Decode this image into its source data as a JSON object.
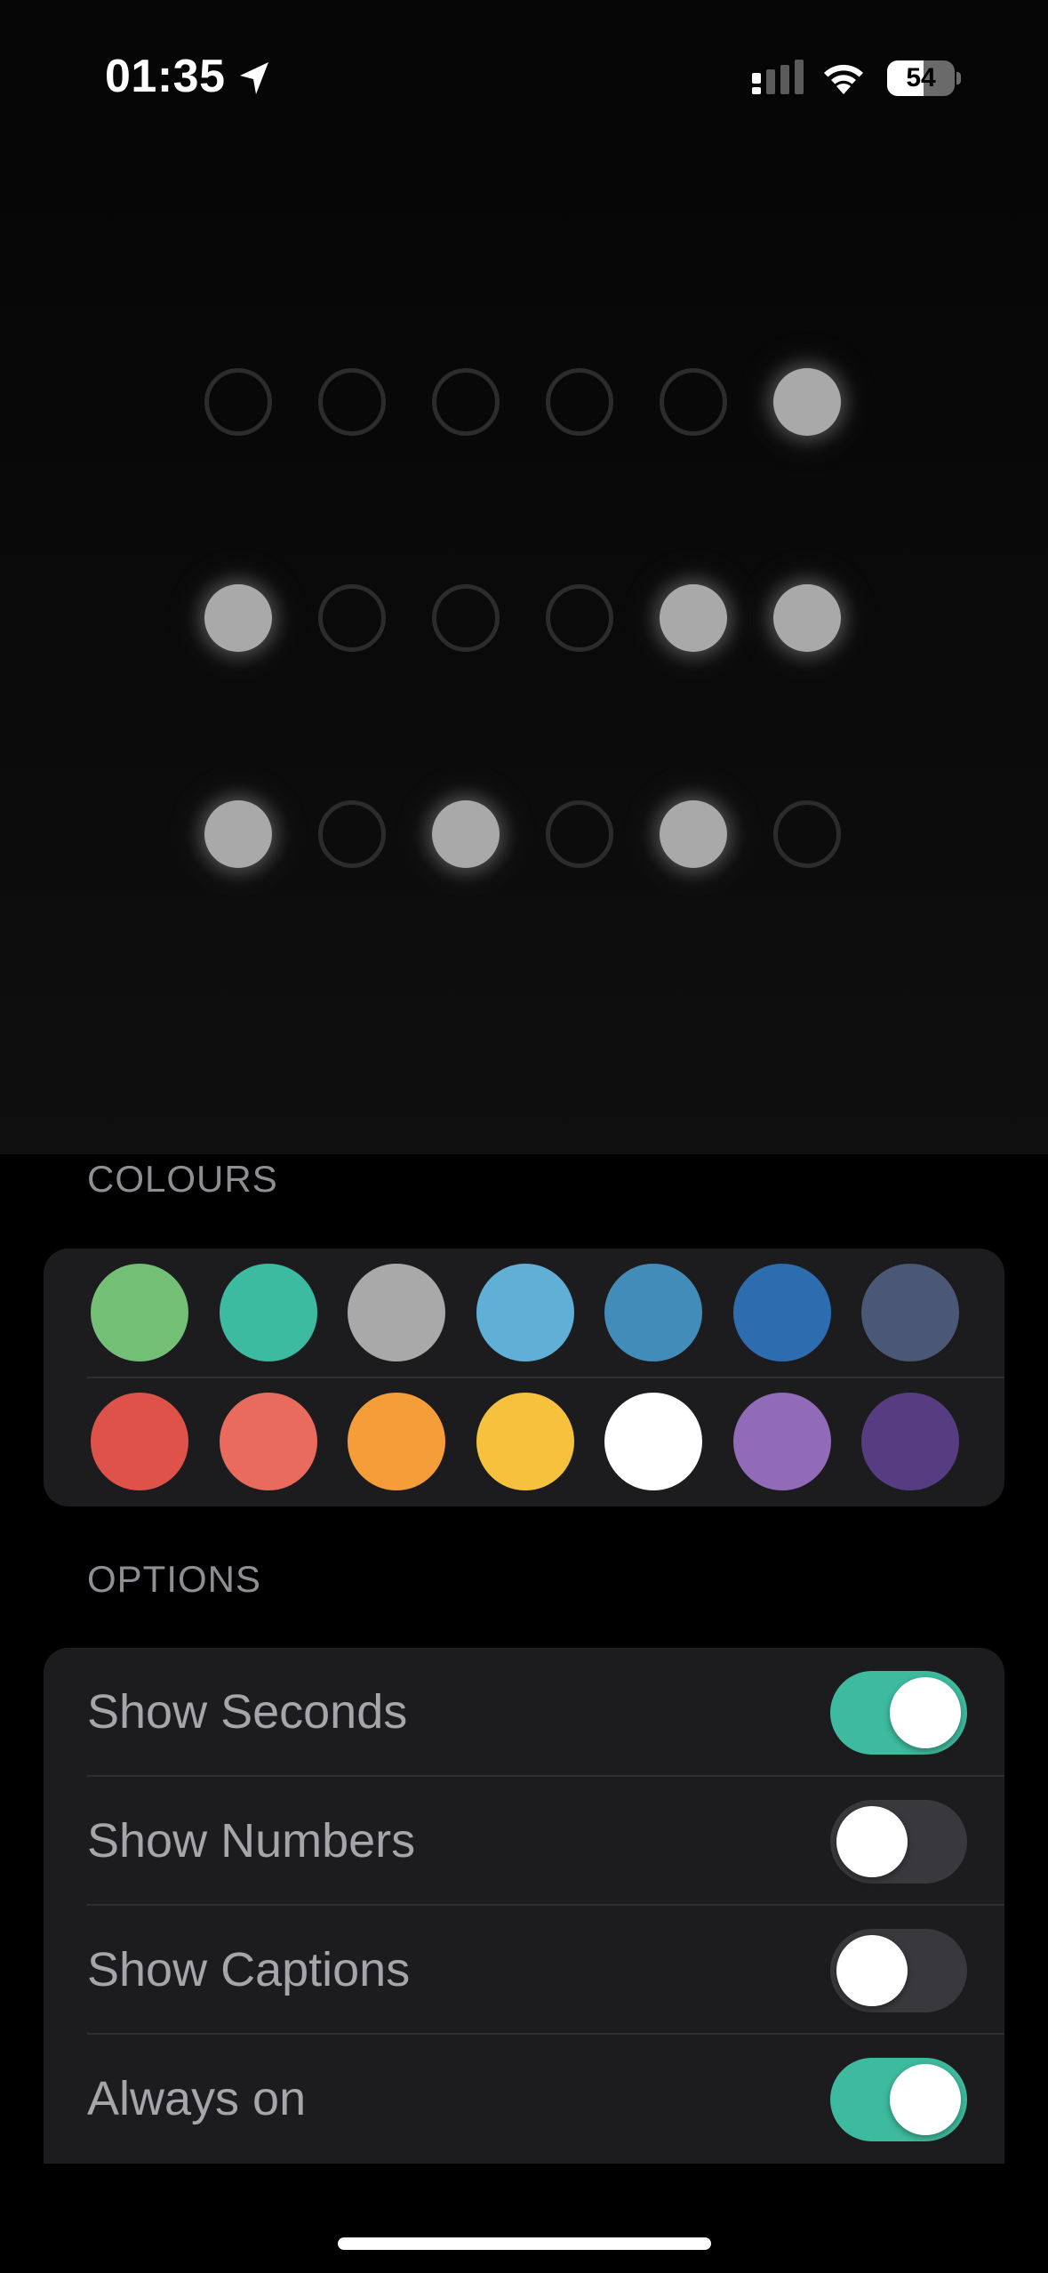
{
  "status_bar": {
    "time": "01:35",
    "location_icon": "location-arrow-icon",
    "signal_icon": "cellular-signal-icon",
    "wifi_icon": "wifi-icon",
    "battery_percent": 54
  },
  "binary_clock": {
    "dot_on_color": "#a9a9a9",
    "rows": [
      [
        0,
        0,
        0,
        0,
        0,
        1
      ],
      [
        1,
        0,
        0,
        0,
        1,
        1
      ],
      [
        1,
        0,
        1,
        0,
        1,
        0
      ]
    ]
  },
  "colours": {
    "header": "COLOURS",
    "swatches": [
      [
        "#72bf75",
        "#3dbba0",
        "#a9a9a9",
        "#5fafd6",
        "#428cb9",
        "#2c6caf",
        "#4a5775"
      ],
      [
        "#df524a",
        "#e86b5d",
        "#f59d38",
        "#f6c13d",
        "#ffffff",
        "#916ab8",
        "#563c80"
      ]
    ]
  },
  "options": {
    "header": "OPTIONS",
    "accent_color": "#3ebb9e",
    "items": [
      {
        "label": "Show Seconds",
        "enabled": true
      },
      {
        "label": "Show Numbers",
        "enabled": false
      },
      {
        "label": "Show Captions",
        "enabled": false
      },
      {
        "label": "Always on",
        "enabled": true
      }
    ]
  }
}
